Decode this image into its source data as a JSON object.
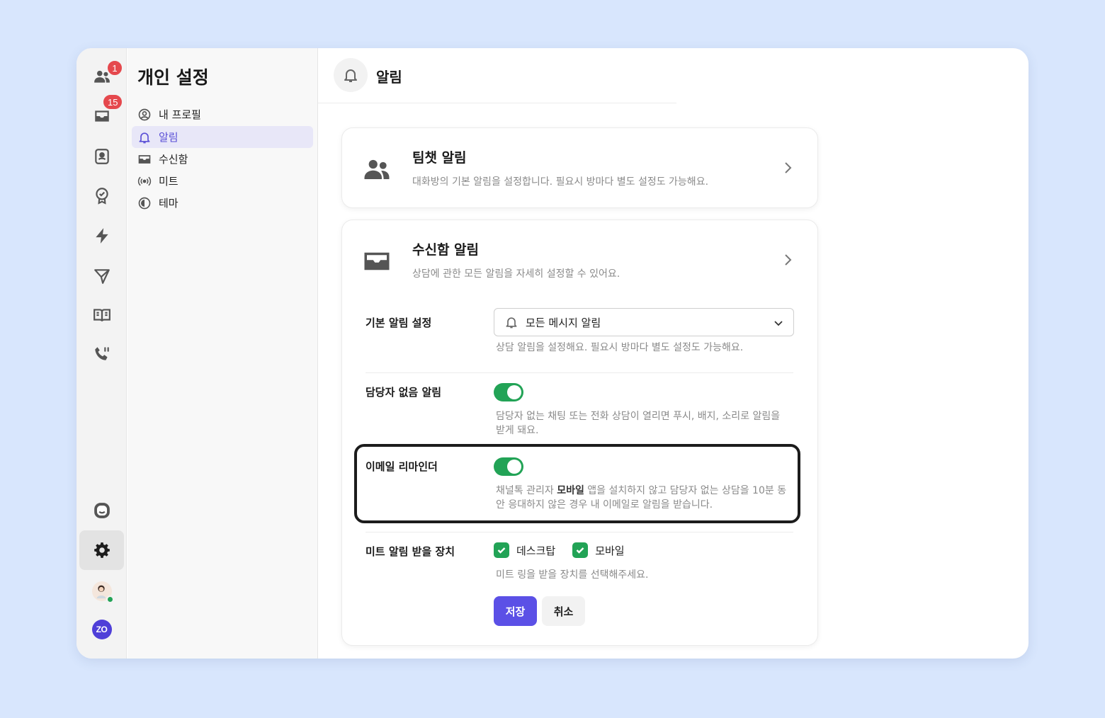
{
  "rail": {
    "contacts_badge": "1",
    "inbox_badge": "15"
  },
  "settings_nav": {
    "title": "개인 설정",
    "items": [
      {
        "label": "내 프로필",
        "icon": "profile-icon"
      },
      {
        "label": "알림",
        "icon": "bell-icon",
        "active": true
      },
      {
        "label": "수신함",
        "icon": "inbox-icon"
      },
      {
        "label": "미트",
        "icon": "broadcast-icon"
      },
      {
        "label": "테마",
        "icon": "theme-icon"
      }
    ]
  },
  "page": {
    "title": "알림"
  },
  "teamchat_card": {
    "title": "팀챗 알림",
    "desc": "대화방의 기본 알림을 설정합니다. 필요시 방마다 별도 설정도 가능해요."
  },
  "inbox_card": {
    "title": "수신함 알림",
    "desc": "상담에 관한 모든 알림을 자세히 설정할 수 있어요.",
    "default_setting": {
      "label": "기본 알림 설정",
      "value": "모든 메시지 알림",
      "desc": "상담 알림을 설정해요. 필요시 방마다 별도 설정도 가능해요."
    },
    "unassigned": {
      "label": "담당자 없음 알림",
      "enabled": true,
      "desc_line1": "담당자 없는 채팅 또는 전화 상담이 열리면 푸시, 배지, 소리로 알림을",
      "desc_line2": "받게 돼요."
    },
    "email_reminder": {
      "label": "이메일 리마인더",
      "enabled": true,
      "desc_pre": "채널톡 관리자 ",
      "desc_bold": "모바일",
      "desc_post": " 앱을 설치하지 않고 담당자 없는 상담을 10분 동",
      "desc_line2": "안 응대하지 않은 경우 내 이메일로 알림을 받습니다."
    },
    "meet_devices": {
      "label": "미트 알림 받을 장치",
      "options": [
        {
          "label": "데스크탑",
          "checked": true
        },
        {
          "label": "모바일",
          "checked": true
        }
      ],
      "desc": "미트 링을 받을 장치를 선택해주세요."
    },
    "save_label": "저장",
    "cancel_label": "취소"
  },
  "colors": {
    "accent": "#5b50e6",
    "toggle_on": "#22a356",
    "badge": "#e5484d"
  }
}
